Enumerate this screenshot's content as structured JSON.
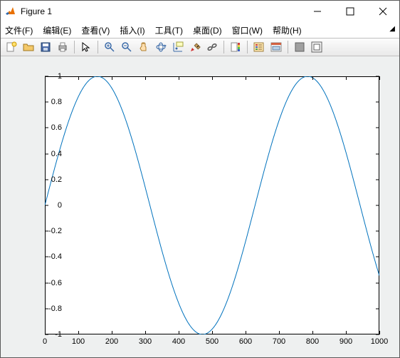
{
  "window": {
    "title": "Figure 1"
  },
  "menu": {
    "items": [
      "文件(F)",
      "编辑(E)",
      "查看(V)",
      "插入(I)",
      "工具(T)",
      "桌面(D)",
      "窗口(W)",
      "帮助(H)"
    ]
  },
  "toolbar": {
    "icons": [
      "new-figure-icon",
      "open-icon",
      "save-icon",
      "print-icon",
      "sep",
      "pointer-icon",
      "sep",
      "zoom-in-icon",
      "zoom-out-icon",
      "pan-icon",
      "rotate3d-icon",
      "data-cursor-icon",
      "brush-icon",
      "link-icon",
      "sep",
      "colorbar-icon",
      "sep",
      "legend-icon",
      "plot-editor-icon",
      "sep",
      "hide-tools-icon",
      "dock-icon"
    ]
  },
  "chart_data": {
    "type": "line",
    "x": [
      0,
      50,
      100,
      150,
      200,
      250,
      300,
      350,
      400,
      450,
      500,
      550,
      600,
      650,
      700,
      750,
      800,
      850,
      900,
      950,
      1000
    ],
    "y": [
      0,
      0.476,
      0.841,
      0.997,
      0.909,
      0.599,
      0.141,
      -0.351,
      -0.757,
      -0.978,
      -0.959,
      -0.706,
      -0.279,
      0.215,
      0.657,
      0.938,
      0.989,
      0.798,
      0.412,
      -0.075,
      -0.544
    ],
    "title": "",
    "xlabel": "",
    "ylabel": "",
    "x_ticks": [
      0,
      100,
      200,
      300,
      400,
      500,
      600,
      700,
      800,
      900,
      1000
    ],
    "y_ticks": [
      -1,
      -0.8,
      -0.6,
      -0.4,
      -0.2,
      0,
      0.2,
      0.4,
      0.6,
      0.8,
      1
    ],
    "xlim": [
      0,
      1000
    ],
    "ylim": [
      -1,
      1
    ],
    "line_color": "#0072BD"
  }
}
